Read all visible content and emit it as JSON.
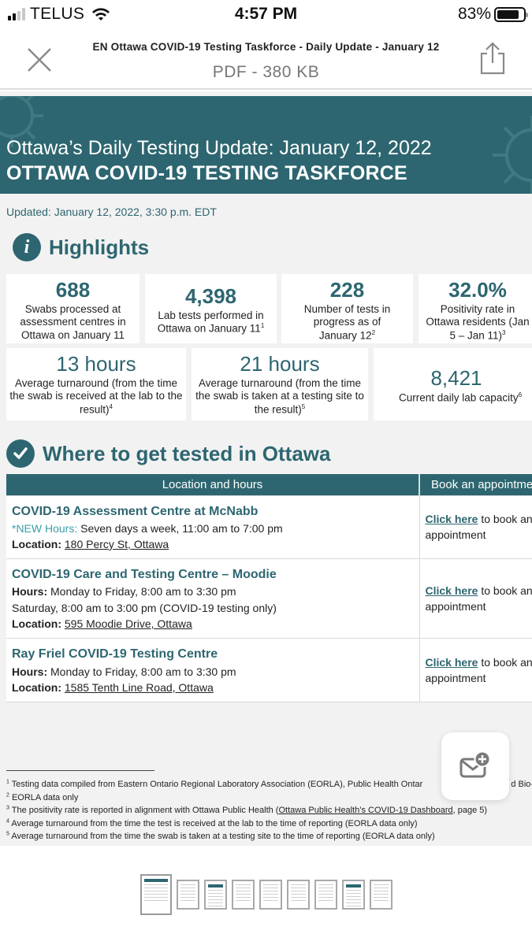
{
  "status_bar": {
    "carrier": "TELUS",
    "time": "4:57 PM",
    "battery_percent": "83%",
    "battery_level": 0.83,
    "signal_bars_active": 2,
    "signal_bars_total": 4
  },
  "viewer": {
    "title": "EN Ottawa COVID-19 Testing Taskforce - Daily Update - January 12",
    "meta": "PDF - 380 KB",
    "close_icon": "close-icon",
    "share_icon": "share-icon"
  },
  "document": {
    "banner_line1": "Ottawa’s Daily Testing Update: January 12, 2022",
    "banner_line2": "OTTAWA COVID-19 TESTING TASKFORCE",
    "updated": "Updated: January 12, 2022, 3:30 p.m. EDT",
    "highlights": {
      "title": "Highlights",
      "icon": "info-icon",
      "cards": [
        {
          "value": "688",
          "desc": "Swabs processed at assessment centres in Ottawa on January 11",
          "note": ""
        },
        {
          "value": "4,398",
          "desc": "Lab tests performed in Ottawa on January 11",
          "note": "1"
        },
        {
          "value": "228",
          "desc": "Number of tests in progress as of January 12",
          "note": "2"
        },
        {
          "value": "32.0%",
          "desc": "Positivity rate in Ottawa residents (Jan 5 – Jan 11)",
          "note": "3"
        },
        {
          "value": "13 hours",
          "desc": "Average turnaround (from the time the swab is received at the lab to the result)",
          "note": "4"
        },
        {
          "value": "21 hours",
          "desc": "Average turnaround (from the time the swab is taken at a testing site to the result)",
          "note": "5"
        },
        {
          "value": "8,421",
          "desc": "Current daily lab capacity",
          "note": "6"
        }
      ]
    },
    "where": {
      "title": "Where to get tested in Ottawa",
      "icon": "checkmark-icon",
      "headers": [
        "Location and hours",
        "Book an appointme"
      ],
      "rows": [
        {
          "name": "COVID-19 Assessment Centre at McNabb",
          "hours_label": "*NEW Hours:",
          "hours": "Seven days a week, 11:00 am to 7:00 pm",
          "extra": "",
          "location_label": "Location:",
          "location": "180 Percy St, Ottawa",
          "link": "Click here",
          "link_rest": "to book an appointment"
        },
        {
          "name": "COVID-19 Care and Testing Centre – Moodie",
          "hours_label": "Hours:",
          "hours": "Monday to Friday, 8:00 am to 3:30 pm",
          "extra": "Saturday, 8:00 am to 3:00 pm (COVID-19 testing only)",
          "location_label": "Location:",
          "location": "595 Moodie Drive, Ottawa",
          "link": "Click here",
          "link_rest": "to book an appointment"
        },
        {
          "name": "Ray Friel COVID-19 Testing Centre",
          "hours_label": "Hours:",
          "hours": "Monday to Friday, 8:00 am to 3:30 pm",
          "extra": "",
          "location_label": "Location:",
          "location": "1585 Tenth Line Road, Ottawa",
          "link": "Click here",
          "link_rest": "to book an appointment"
        }
      ]
    },
    "footnotes": [
      {
        "n": "1",
        "text": "Testing data compiled from Eastern Ontario Regional Laboratory Association (EORLA), Public Health Ontar",
        "tail": "d Bio-"
      },
      {
        "n": "2",
        "text": "EORLA data only"
      },
      {
        "n": "3",
        "text_before": "The positivity rate is reported in alignment with Ottawa Public Health (",
        "link": "Ottawa Public Health’s COVID-19 Dashboard",
        "text_after": ", page 5)"
      },
      {
        "n": "4",
        "text": "Average turnaround from the time the test is received at the lab to the time of reporting (EORLA data only)"
      },
      {
        "n": "5",
        "text": "Average turnaround from the time the swab is taken at a testing site to the time of reporting (EORLA data only)"
      }
    ]
  },
  "fab": {
    "icon": "add-mail-icon"
  },
  "thumbnails": {
    "count": 9,
    "active_index": 0
  },
  "colors": {
    "brand_teal": "#2d6670",
    "accent_teal": "#3a9ea5",
    "page_bg": "#f2f2f2"
  }
}
